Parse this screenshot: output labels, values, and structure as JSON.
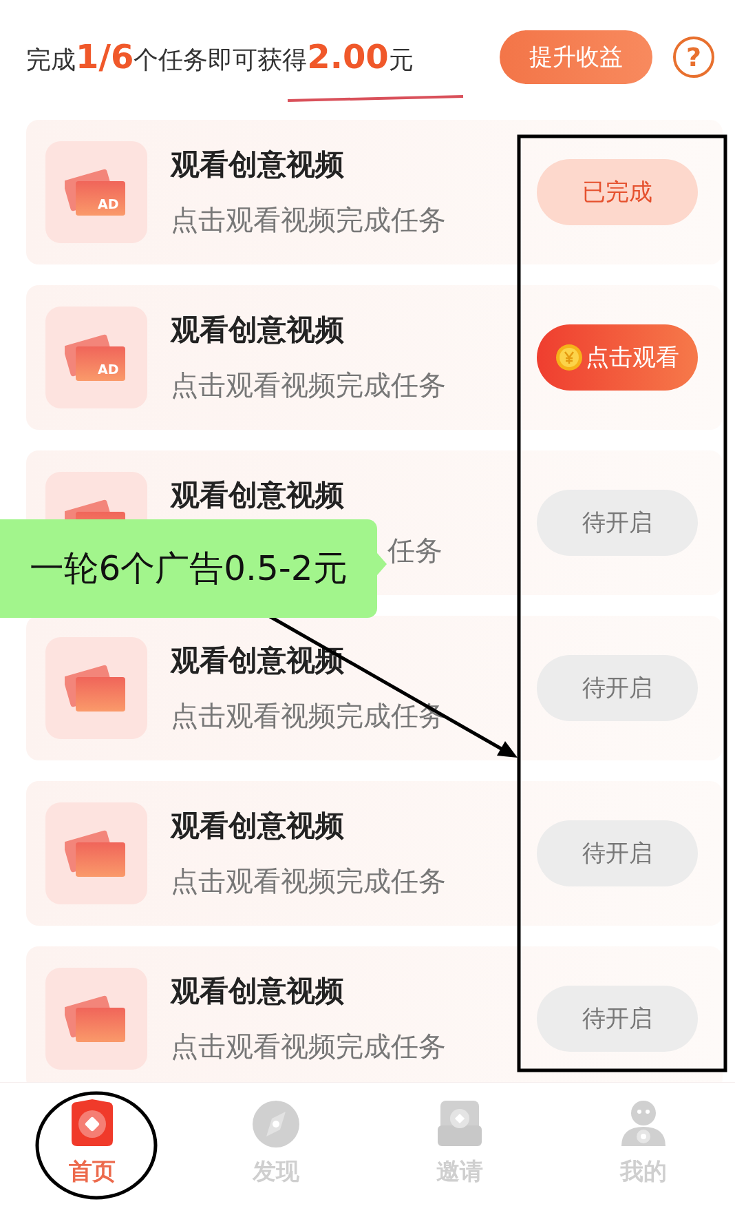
{
  "header": {
    "summary": "完成**1/6**个任务即可获得**2.00**元",
    "boost_button": "提升收益",
    "help_icon": "?"
  },
  "tasks": [
    {
      "title": "观看创意视频",
      "subtitle": "点击观看视频完成任务",
      "ad_label": "AD",
      "completed": true,
      "disabled": false,
      "button": "已完成"
    },
    {
      "title": "观看创意视频",
      "subtitle": "点击观看视频完成任务",
      "ad_label": "AD",
      "completed": false,
      "disabled": false,
      "button": "点击观看"
    },
    {
      "title": "观看创意视频",
      "subtitle": "任务",
      "completed": false,
      "disabled": true,
      "button": "待开启"
    },
    {
      "title": "观看创意视频",
      "subtitle": "点击观看视频完成任务",
      "completed": false,
      "disabled": true,
      "button": "待开启"
    },
    {
      "title": "观看创意视频",
      "subtitle": "点击观看视频完成任务",
      "completed": false,
      "disabled": true,
      "button": "待开启"
    },
    {
      "title": "观看创意视频",
      "subtitle": "点击观看视频完成任务",
      "completed": false,
      "disabled": true,
      "button": "待开启"
    }
  ],
  "tab_bar": [
    {
      "label": "首页",
      "selected": true
    },
    {
      "label": "发现",
      "selected": false
    },
    {
      "label": "邀请",
      "selected": false
    },
    {
      "label": "我的",
      "selected": false
    }
  ],
  "annotation": {
    "callout": "一轮6个广告0.5-2元"
  }
}
